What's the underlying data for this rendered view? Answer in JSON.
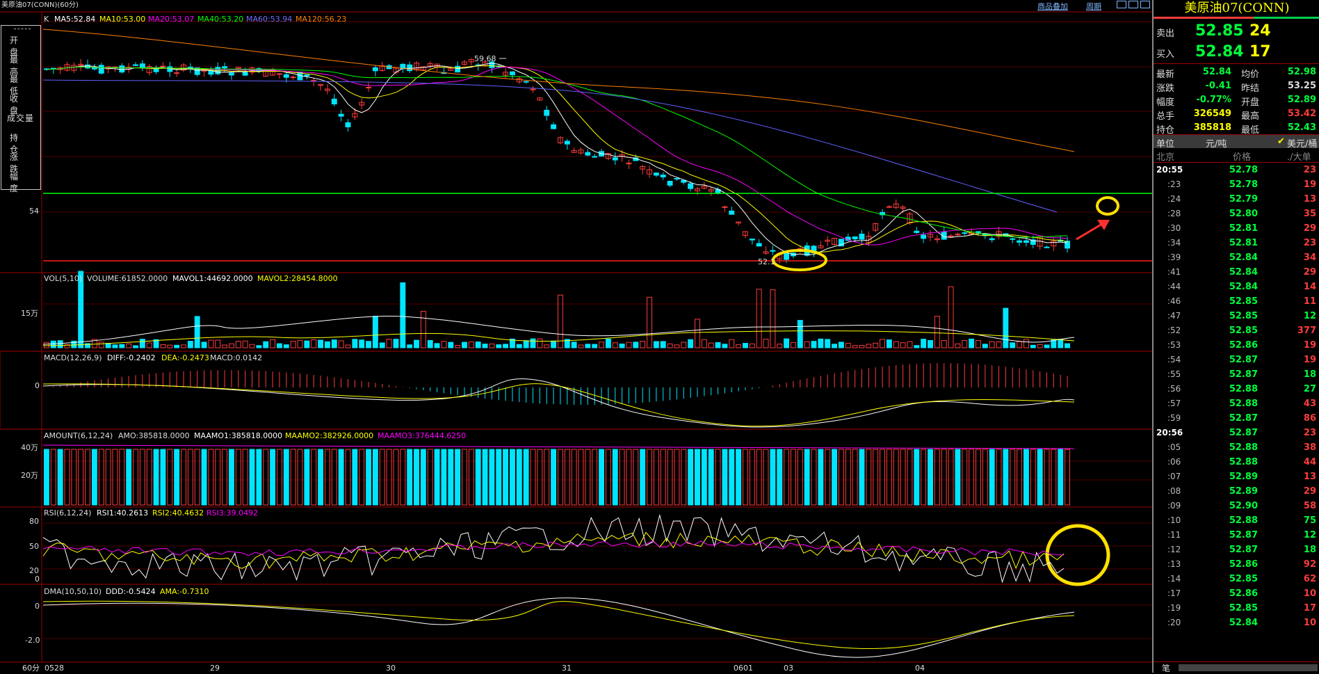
{
  "title": "美原油07(CONN)(60分)",
  "top_links": {
    "overlay": "商品叠加",
    "period": "周期"
  },
  "left_menu": [
    "开 盘",
    "最 高",
    "最 低",
    "收 盘",
    "成交量",
    "持 仓",
    "涨 跌",
    "幅 度"
  ],
  "k_indicators": {
    "k": "K",
    "ma5": "MA5:52.84",
    "ma10": "MA10:53.00",
    "ma20": "MA20:53.07",
    "ma40": "MA40:53.20",
    "ma60": "MA60:53.94",
    "ma120": "MA120:56.23"
  },
  "k_labels": {
    "high": "59.68",
    "low": "52.1",
    "axis54": "54"
  },
  "vol_indicators": {
    "label": "VOL(5,10)",
    "volume": "VOLUME:61852.0000",
    "mavol1": "MAVOL1:44692.0000",
    "mavol2": "MAVOL2:28454.8000",
    "axis": "15万"
  },
  "macd_indicators": {
    "label": "MACD(12,26,9)",
    "diff": "DIFF:-0.2402",
    "dea": "DEA:-0.2473",
    "macd": "MACD:0.0142",
    "axis": "0"
  },
  "amount_indicators": {
    "label": "AMOUNT(6,12,24)",
    "amo": "AMO:385818.0000",
    "amo1": "MAAMO1:385818.0000",
    "amo2": "MAAMO2:382926.0000",
    "amo3": "MAAMO3:376444.6250",
    "axis40": "40万",
    "axis20": "20万"
  },
  "rsi_indicators": {
    "label": "RSI(6,12,24)",
    "rsi1": "RSI1:40.2613",
    "rsi2": "RSI2:40.4632",
    "rsi3": "RSI3:39.0492",
    "ax80": "80",
    "ax50": "50",
    "ax20": "20",
    "ax0": "0"
  },
  "dma_indicators": {
    "label": "DMA(10,50,10)",
    "ddd": "DDD:-0.5424",
    "ama": "AMA:-0.7310",
    "ax0": "0",
    "axm2": "-2.0"
  },
  "x_axis": {
    "period": "60分",
    "labels": [
      "0528",
      "29",
      "30",
      "31",
      "0601",
      "03",
      "04"
    ]
  },
  "quote": {
    "title": "美原油07(CONN)",
    "sell_label": "卖出",
    "sell_price": "52.85",
    "sell_vol": "24",
    "buy_label": "买入",
    "buy_price": "52.84",
    "buy_vol": "17",
    "stats": [
      [
        "最新",
        "52.84",
        "均价",
        "52.98"
      ],
      [
        "涨跌",
        "-0.41",
        "昨结",
        "53.25"
      ],
      [
        "幅度",
        "-0.77%",
        "开盘",
        "52.89"
      ],
      [
        "总手",
        "326549",
        "最高",
        "53.42"
      ],
      [
        "持仓",
        "385818",
        "最低",
        "52.43"
      ]
    ],
    "unit_label": "单位",
    "unit_cny": "元/吨",
    "unit_usd": "美元/桶",
    "hdr_time": "北京",
    "hdr_price": "价格",
    "hdr_vol": "./大单",
    "ticks": [
      [
        "20:55",
        "52.78",
        "23"
      ],
      [
        ":23",
        "52.78",
        "19"
      ],
      [
        ":24",
        "52.79",
        "13"
      ],
      [
        ":28",
        "52.80",
        "35"
      ],
      [
        ":30",
        "52.81",
        "29"
      ],
      [
        ":34",
        "52.81",
        "23"
      ],
      [
        ":39",
        "52.84",
        "34"
      ],
      [
        ":41",
        "52.84",
        "29"
      ],
      [
        ":44",
        "52.84",
        "14"
      ],
      [
        ":46",
        "52.85",
        "11"
      ],
      [
        ":47",
        "52.85",
        "12"
      ],
      [
        ":52",
        "52.85",
        "377"
      ],
      [
        ":53",
        "52.86",
        "19"
      ],
      [
        ":54",
        "52.87",
        "19"
      ],
      [
        ":55",
        "52.87",
        "18"
      ],
      [
        ":56",
        "52.88",
        "27"
      ],
      [
        ":57",
        "52.88",
        "43"
      ],
      [
        ":59",
        "52.87",
        "86"
      ],
      [
        "20:56",
        "52.87",
        "23"
      ],
      [
        ":05",
        "52.88",
        "38"
      ],
      [
        ":06",
        "52.88",
        "44"
      ],
      [
        ":07",
        "52.89",
        "13"
      ],
      [
        ":08",
        "52.89",
        "29"
      ],
      [
        ":09",
        "52.90",
        "58"
      ],
      [
        ":10",
        "52.88",
        "75"
      ],
      [
        ":11",
        "52.87",
        "12"
      ],
      [
        ":12",
        "52.87",
        "18"
      ],
      [
        ":13",
        "52.86",
        "92"
      ],
      [
        ":14",
        "52.85",
        "62"
      ],
      [
        ":17",
        "52.86",
        "10"
      ],
      [
        ":19",
        "52.85",
        "17"
      ],
      [
        ":20",
        "52.84",
        "10"
      ]
    ],
    "footer": "笔"
  },
  "colors": {
    "bg": "#000000",
    "up": "#ff3c3c",
    "down": "#00e5ff",
    "ma5": "#ffffff",
    "ma10": "#ffff00",
    "ma20": "#ff00ff",
    "ma40": "#00ff00",
    "ma60": "#6060ff",
    "ma120": "#ff8000",
    "grid": "#a00000"
  }
}
